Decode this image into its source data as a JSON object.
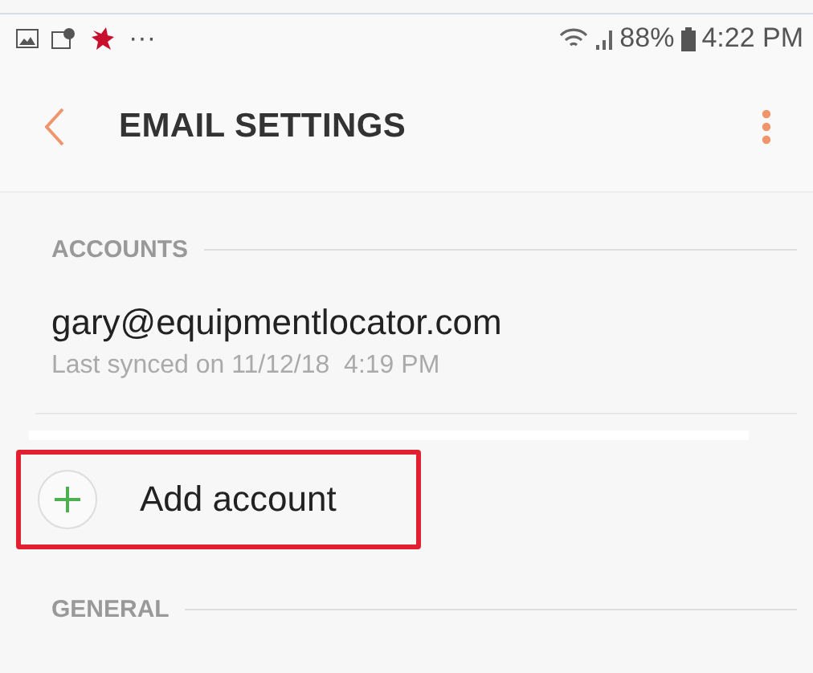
{
  "status_bar": {
    "more": "···",
    "battery": "88%",
    "time": "4:22 PM"
  },
  "header": {
    "title": "EMAIL SETTINGS"
  },
  "sections": [
    {
      "title": "ACCOUNTS",
      "accounts": [
        {
          "email": "gary@equipmentlocator.com",
          "synced": "Last synced on 11/12/18  4:19 PM"
        }
      ],
      "add_account": {
        "label": "Add account",
        "highlighted": true
      }
    },
    {
      "title": "GENERAL"
    }
  ]
}
